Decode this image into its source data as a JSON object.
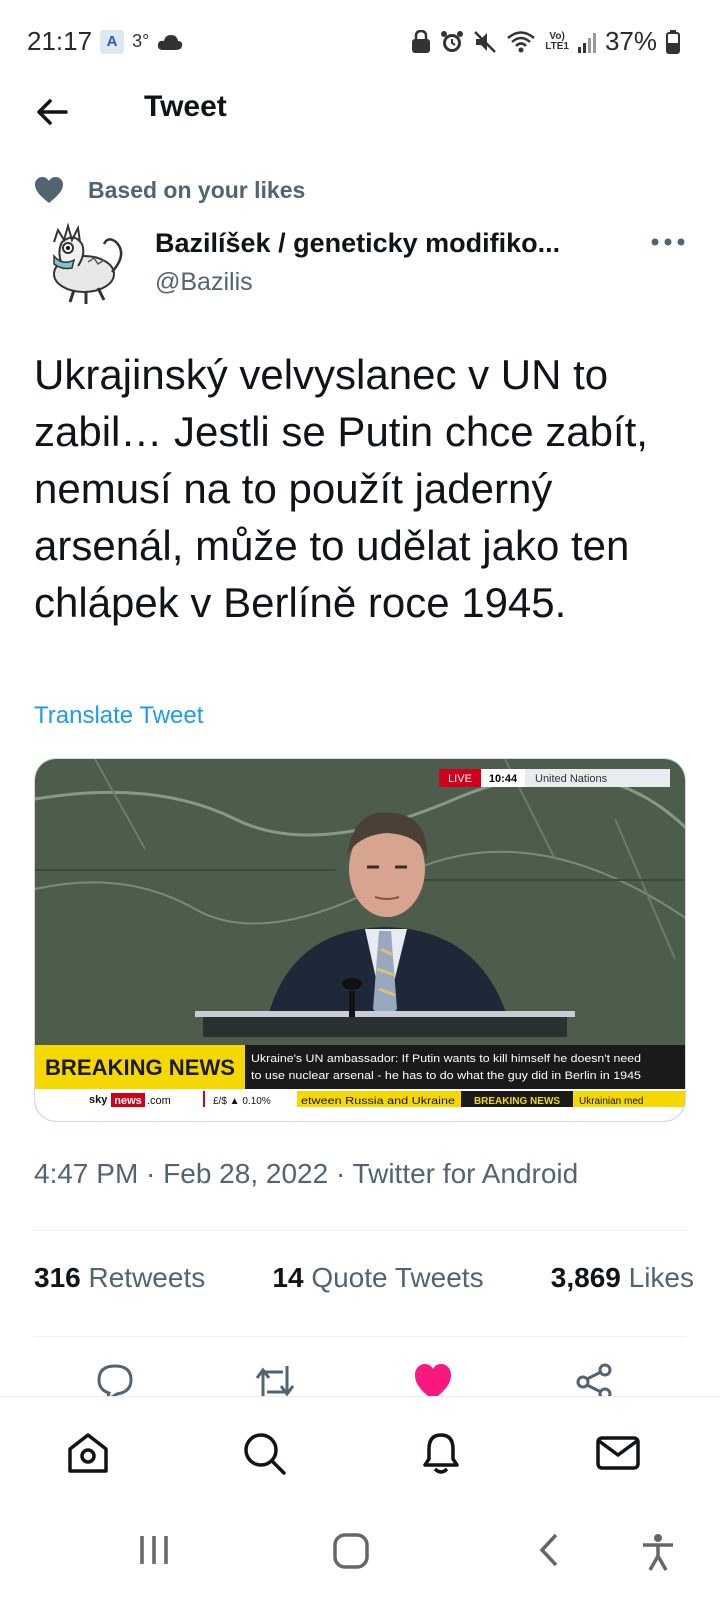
{
  "status_bar": {
    "time": "21:17",
    "app_badge": "A",
    "temperature": "3°",
    "network": "VoLTE1",
    "network_top": "Vo)",
    "network_bottom": "LTE1",
    "battery": "37%"
  },
  "header": {
    "title": "Tweet"
  },
  "context": {
    "label": "Based on your likes"
  },
  "author": {
    "name": "Bazilíšek / geneticky modifiko...",
    "handle": "@Bazilis"
  },
  "tweet": {
    "text": "Ukrajinský velvyslanec v UN to zabil… Jestli se Putin chce zabít, nemusí na to použít jaderný arsenál, může to udělat jako ten chlápek v Berlíně roce 1945.",
    "translate_label": "Translate Tweet",
    "meta": "4:47 PM · Feb 28, 2022 · Twitter for Android"
  },
  "media": {
    "live_label": "LIVE",
    "clock": "10:44",
    "location": "United Nations",
    "breaking_label": "BREAKING NEWS",
    "headline_1": "Ukraine's UN ambassador: If Putin wants to kill himself he doesn't need",
    "headline_2": "to use nuclear arsenal - he has to do what the guy did in Berlin in 1945",
    "sky_brand": "sky",
    "news_label": "news",
    "dotcom": ".com",
    "fx": "£/$ ▲ 0.10%",
    "ticker_1": "etween Russia and Ukraine",
    "ticker_breaking": "BREAKING NEWS",
    "ticker_2": "Ukrainian med"
  },
  "stats": {
    "retweets_count": "316",
    "retweets_label": "Retweets",
    "quotes_count": "14",
    "quotes_label": "Quote Tweets",
    "likes_count": "3,869",
    "likes_label": "Likes"
  },
  "actions": [
    "reply-icon",
    "retweet-icon",
    "like-icon-filled",
    "share-icon"
  ],
  "bottom_nav": [
    "home-icon",
    "search-icon",
    "notifications-icon",
    "messages-icon"
  ],
  "colors": {
    "accent": "#1d9bf0",
    "like": "#f91880",
    "secondary_text": "#536471",
    "breaking_yellow": "#f5d800"
  }
}
